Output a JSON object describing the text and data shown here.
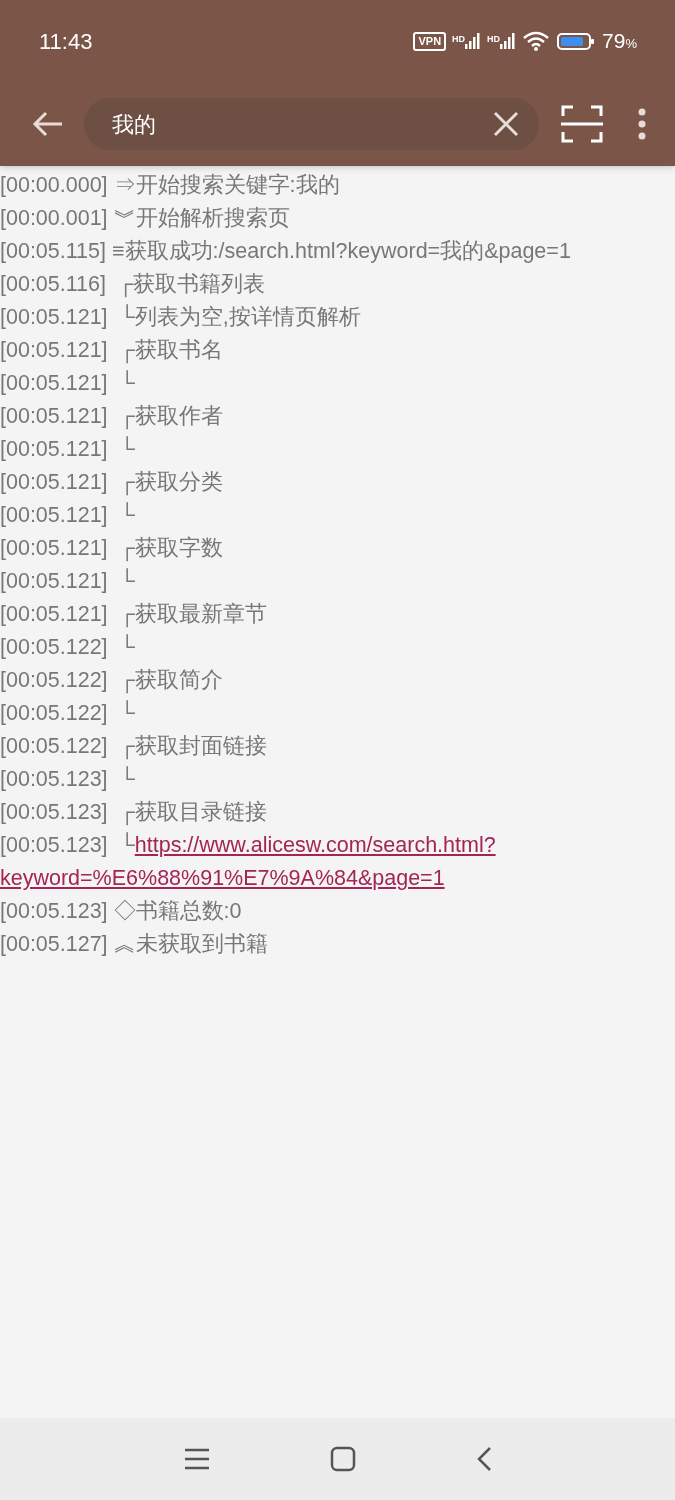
{
  "status_bar": {
    "time": "11:43",
    "vpn": "VPN",
    "signals": [
      "HD",
      "HD"
    ],
    "battery": "79",
    "battery_unit": "%"
  },
  "search": {
    "value": "我的"
  },
  "log": [
    {
      "kind": "text",
      "text": "[00:00.000] ⇒开始搜索关键字:我的"
    },
    {
      "kind": "text",
      "text": "[00:00.001] ︾开始解析搜索页"
    },
    {
      "kind": "text",
      "text": "[00:05.115] ≡获取成功:/search.html?keyword=我的&page=1"
    },
    {
      "kind": "text",
      "text": "[00:05.116]  ┌获取书籍列表"
    },
    {
      "kind": "text",
      "text": "[00:05.121]  └列表为空,按详情页解析"
    },
    {
      "kind": "text",
      "text": "[00:05.121]  ┌获取书名"
    },
    {
      "kind": "text",
      "text": "[00:05.121]  └"
    },
    {
      "kind": "text",
      "text": "[00:05.121]  ┌获取作者"
    },
    {
      "kind": "text",
      "text": "[00:05.121]  └"
    },
    {
      "kind": "text",
      "text": "[00:05.121]  ┌获取分类"
    },
    {
      "kind": "text",
      "text": "[00:05.121]  └"
    },
    {
      "kind": "text",
      "text": "[00:05.121]  ┌获取字数"
    },
    {
      "kind": "text",
      "text": "[00:05.121]  └"
    },
    {
      "kind": "text",
      "text": "[00:05.121]  ┌获取最新章节"
    },
    {
      "kind": "text",
      "text": "[00:05.122]  └"
    },
    {
      "kind": "text",
      "text": "[00:05.122]  ┌获取简介"
    },
    {
      "kind": "text",
      "text": "[00:05.122]  └"
    },
    {
      "kind": "text",
      "text": "[00:05.122]  ┌获取封面链接"
    },
    {
      "kind": "text",
      "text": "[00:05.123]  └"
    },
    {
      "kind": "text",
      "text": "[00:05.123]  ┌获取目录链接"
    },
    {
      "kind": "link",
      "text": "[00:05.123]  └",
      "link": [
        "https://www.alicesw.com/search.html?",
        "keyword=%E6%88%91%E7%9A%84&page=1"
      ]
    },
    {
      "kind": "text",
      "text": "[00:05.123] ◇书籍总数:0"
    },
    {
      "kind": "text",
      "text": "[00:05.127] ︽未获取到书籍"
    }
  ]
}
